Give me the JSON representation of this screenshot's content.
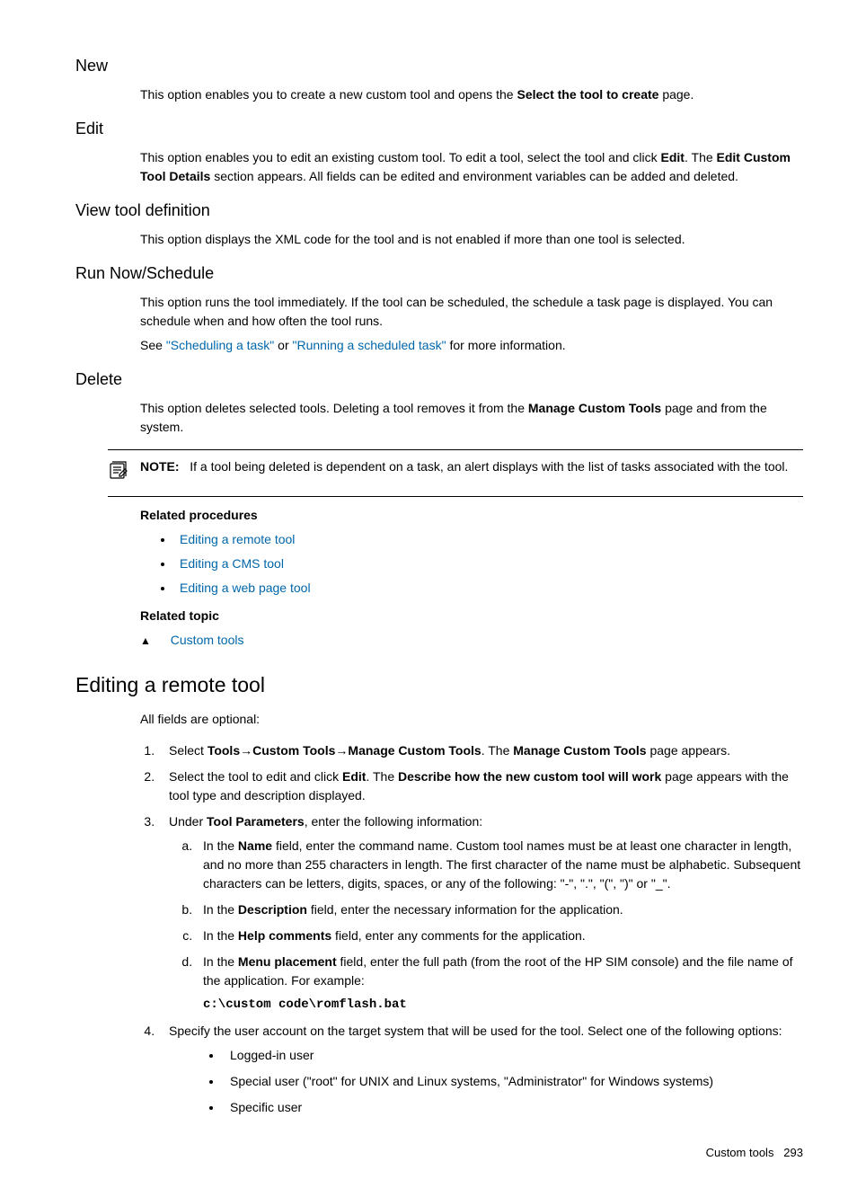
{
  "sections": {
    "new": {
      "heading": "New",
      "body_pre": "This option enables you to create a new custom tool and opens the ",
      "body_bold": "Select the tool to create",
      "body_post": " page."
    },
    "edit": {
      "heading": "Edit",
      "body_pre": "This option enables you to edit an existing custom tool. To edit a tool, select the tool and click ",
      "bold1": "Edit",
      "mid": ". The ",
      "bold2": "Edit Custom Tool Details",
      "body_post": " section appears. All fields can be edited and environment variables can be added and deleted."
    },
    "view": {
      "heading": "View tool definition",
      "body": "This option displays the XML code for the tool and is not enabled if more than one tool is selected."
    },
    "run": {
      "heading": "Run Now/Schedule",
      "body1": "This option runs the tool immediately. If the tool can be scheduled, the schedule a task page is displayed. You can schedule when and how often the tool runs.",
      "see_pre": "See ",
      "link1": "\"Scheduling a task\"",
      "see_mid": " or ",
      "link2": "\"Running a scheduled task\"",
      "see_post": " for more information."
    },
    "delete": {
      "heading": "Delete",
      "body_pre": "This option deletes selected tools. Deleting a tool removes it from the ",
      "bold": "Manage Custom Tools",
      "body_post": " page and from the system."
    }
  },
  "note": {
    "label": "NOTE:",
    "text": "If a tool being deleted is dependent on a task, an alert displays with the list of tasks associated with the tool."
  },
  "related_procedures": {
    "heading": "Related procedures",
    "items": [
      "Editing a remote tool",
      "Editing a CMS tool",
      "Editing a web page tool"
    ]
  },
  "related_topic": {
    "heading": "Related topic",
    "item": "Custom tools"
  },
  "editing_remote": {
    "heading": "Editing a remote tool",
    "intro": "All fields are optional:",
    "step1": {
      "pre": "Select ",
      "b1": "Tools",
      "arrow1": "→",
      "b2": "Custom Tools",
      "arrow2": "→",
      "b3": "Manage Custom Tools",
      "mid": ". The ",
      "b4": "Manage Custom Tools",
      "post": " page appears."
    },
    "step2": {
      "pre": "Select the tool to edit and click ",
      "b1": "Edit",
      "mid": ". The ",
      "b2": "Describe how the new custom tool will work",
      "post": " page appears with the tool type and description displayed."
    },
    "step3": {
      "pre": "Under ",
      "b1": "Tool Parameters",
      "post": ", enter the following information:",
      "a": {
        "pre": "In the ",
        "b": "Name",
        "post": " field, enter the command name. Custom tool names must be at least one character in length, and no more than 255 characters in length. The first character of the name must be alphabetic. Subsequent characters can be letters, digits, spaces, or any of the following: \"-\", \".\", \"(\", \")\" or \"_\"."
      },
      "b_item": {
        "pre": "In the ",
        "b": "Description",
        "post": " field, enter the necessary information for the application."
      },
      "c": {
        "pre": "In the ",
        "b": "Help comments",
        "post": " field, enter any comments for the application."
      },
      "d": {
        "pre": "In the ",
        "b": "Menu placement",
        "post": " field, enter the full path (from the root of the HP SIM console) and the file name of the application. For example:",
        "code": "c:\\custom code\\romflash.bat"
      }
    },
    "step4": {
      "text": "Specify the user account on the target system that will be used for the tool. Select one of the following options:",
      "bullets": [
        "Logged-in user",
        "Special user (\"root\" for UNIX and Linux systems, \"Administrator\" for Windows systems)",
        "Specific user"
      ]
    }
  },
  "footer": {
    "text": "Custom tools",
    "page": "293"
  }
}
